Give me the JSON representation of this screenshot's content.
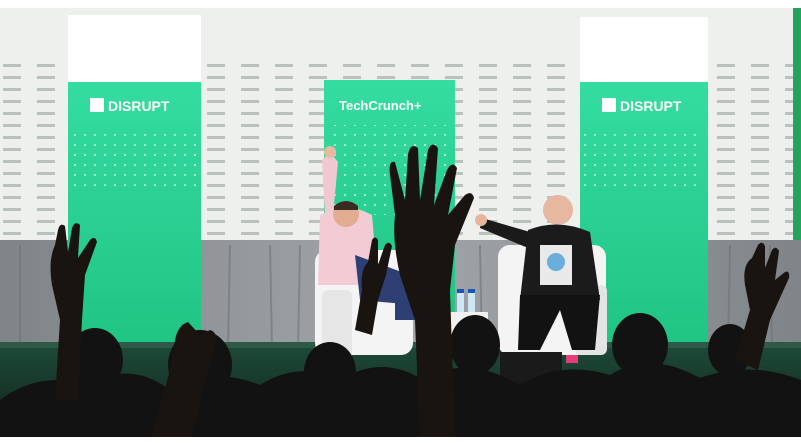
{
  "photo": {
    "banner_left": "DISRUPT",
    "banner_center": "TechCrunch+",
    "banner_right": "DISRUPT",
    "colors": {
      "banner_green": "#2fd89a",
      "banner_green_dark": "#1fbf82",
      "backdrop": "#eef0ee",
      "curtain": "#8e9296",
      "stage_floor": "#173a2c",
      "silhouette": "#121212"
    }
  }
}
